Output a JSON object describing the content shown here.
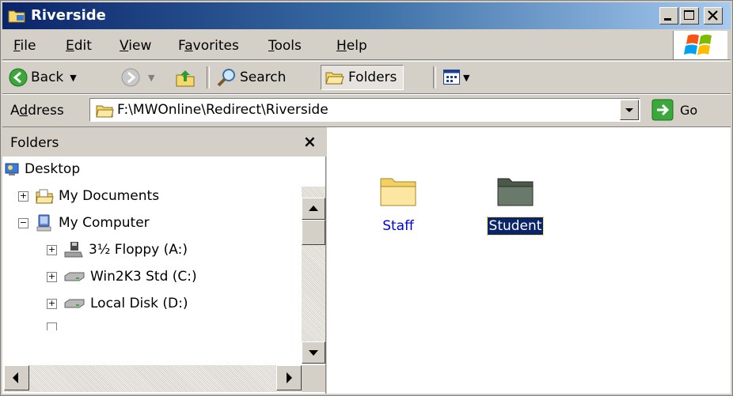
{
  "window": {
    "title": "Riverside"
  },
  "menu": {
    "items": [
      {
        "label": "File",
        "ul": "F",
        "rest": "ile"
      },
      {
        "label": "Edit",
        "ul": "E",
        "rest": "dit"
      },
      {
        "label": "View",
        "ul": "V",
        "rest": "iew"
      },
      {
        "label": "Favorites",
        "pre": "F",
        "ul": "a",
        "rest": "vorites"
      },
      {
        "label": "Tools",
        "ul": "T",
        "rest": "ools"
      },
      {
        "label": "Help",
        "ul": "H",
        "rest": "elp"
      }
    ]
  },
  "toolbar": {
    "back_label": "Back",
    "search_label": "Search",
    "folders_label": "Folders"
  },
  "address": {
    "label_pre": "A",
    "label_ul": "d",
    "label_rest": "dress",
    "value": "F:\\MWOnline\\Redirect\\Riverside",
    "go_label": "Go"
  },
  "folder_pane": {
    "title": "Folders",
    "close_glyph": "×",
    "tree": [
      {
        "label": "Desktop",
        "icon": "desktop-icon",
        "expander": ""
      },
      {
        "label": "My Documents",
        "icon": "documents-folder-icon",
        "expander": "+"
      },
      {
        "label": "My Computer",
        "icon": "computer-icon",
        "expander": "−"
      },
      {
        "label": "3½ Floppy (A:)",
        "icon": "floppy-drive-icon",
        "expander": "+"
      },
      {
        "label": "Win2K3 Std (C:)",
        "icon": "hard-drive-icon",
        "expander": "+"
      },
      {
        "label": "Local Disk (D:)",
        "icon": "hard-drive-icon",
        "expander": "+"
      }
    ]
  },
  "content": {
    "folders": [
      {
        "name": "Staff",
        "selected": false
      },
      {
        "name": "Student",
        "selected": true
      }
    ]
  },
  "colors": {
    "title_start": "#0a246a",
    "title_end": "#a6caf0",
    "selection": "#0a246a",
    "link": "#0000ee"
  }
}
